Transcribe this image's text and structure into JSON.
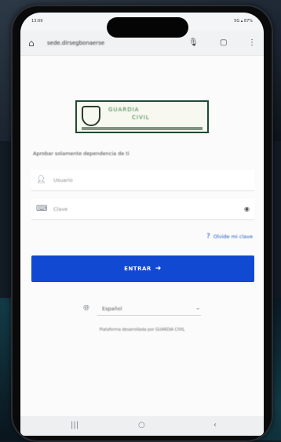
{
  "status": {
    "time": "13:09",
    "indicators": "5G ▴ 87%"
  },
  "browser": {
    "home_icon": "home-icon",
    "url": "sede.dirsegbonaerse",
    "icons": [
      "mic-icon",
      "tabs-icon",
      "menu-icon"
    ]
  },
  "logo": {
    "line1": "GUARDIA",
    "line2": "CIVIL"
  },
  "subtitle": "Aprobar solamente dependencia de ti",
  "form": {
    "user_placeholder": "Usuario",
    "password_placeholder": "Clave",
    "forgot_label": "Olvide mi clave",
    "login_label": "ENTRAR"
  },
  "language": {
    "selected": "Español"
  },
  "footer": "Plataforma desarrollada por GUARDIA CIVIL",
  "colors": {
    "accent": "#1149d3",
    "link": "#1b57b5",
    "logo_border": "#1f4a30"
  }
}
